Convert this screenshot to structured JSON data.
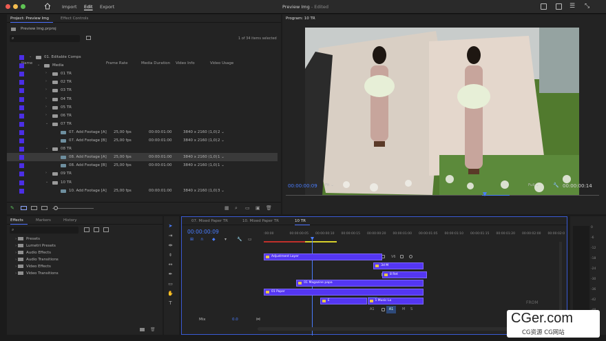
{
  "topbar": {
    "home_icon": "home-icon",
    "nav": [
      "Import",
      "Edit",
      "Export"
    ],
    "active": "Edit",
    "title": "Preview Img",
    "title_suffix": " - Edited"
  },
  "project": {
    "tabs": [
      "Project: Preview Img",
      "Effect Controls"
    ],
    "path": "Preview Img.prproj",
    "search_placeholder": "",
    "count": "1 of 34 items selected",
    "columns": [
      "Name",
      "Frame Rate",
      "Media Duration",
      "Video Info",
      "Video Usage"
    ],
    "rows": [
      {
        "name": "01. Editable Comps",
        "indent": 0,
        "type": "folder",
        "open": true
      },
      {
        "name": "Media",
        "indent": 1,
        "type": "folder",
        "open": true
      },
      {
        "name": "01 TR",
        "indent": 2,
        "type": "folder"
      },
      {
        "name": "02 TR",
        "indent": 2,
        "type": "folder"
      },
      {
        "name": "03 TR",
        "indent": 2,
        "type": "folder"
      },
      {
        "name": "04 TR",
        "indent": 2,
        "type": "folder"
      },
      {
        "name": "05 TR",
        "indent": 2,
        "type": "folder"
      },
      {
        "name": "06 TR",
        "indent": 2,
        "type": "folder"
      },
      {
        "name": "07 TR",
        "indent": 2,
        "type": "folder",
        "open": true
      },
      {
        "name": "07. Add Footage [A]",
        "indent": 3,
        "type": "seq",
        "fps": "25,00 fps",
        "dur": "00:00:01:00",
        "info": "3840 x 2160 (1,0)",
        "usage": "2"
      },
      {
        "name": "07. Add Footage [B]",
        "indent": 3,
        "type": "seq",
        "fps": "25,00 fps",
        "dur": "00:00:01:00",
        "info": "3840 x 2160 (1,0)",
        "usage": "2"
      },
      {
        "name": "08 TR",
        "indent": 2,
        "type": "folder",
        "open": true
      },
      {
        "name": "08. Add Footage [A]",
        "indent": 3,
        "type": "seq",
        "fps": "25,00 fps",
        "dur": "00:00:01:00",
        "info": "3840 x 2160 (1,0)",
        "usage": "1",
        "selected": true
      },
      {
        "name": "08. Add Footage [B]",
        "indent": 3,
        "type": "seq",
        "fps": "25,00 fps",
        "dur": "00:00:01:00",
        "info": "3840 x 2160 (1,0)",
        "usage": "1"
      },
      {
        "name": "09 TR",
        "indent": 2,
        "type": "folder"
      },
      {
        "name": "10 TR",
        "indent": 2,
        "type": "folder",
        "open": true
      },
      {
        "name": "10. Add Footage [A]",
        "indent": 3,
        "type": "seq",
        "fps": "25,00 fps",
        "dur": "00:00:01:00",
        "info": "3840 x 2160 (1,0)",
        "usage": "3"
      }
    ]
  },
  "program": {
    "label": "Program: 10 TR",
    "timecode": "00:00:00:09",
    "fit": "Fit",
    "quality": "Full",
    "duration": "00:00:00:14"
  },
  "effects": {
    "tabs": [
      "Effects",
      "Markers",
      "History"
    ],
    "items": [
      "Presets",
      "Lumetri Presets",
      "Audio Effects",
      "Audio Transitions",
      "Video Effects",
      "Video Transitions"
    ]
  },
  "timeline": {
    "tabs": [
      "07. Mixed Paper TR",
      "10. Mixed Paper TR",
      "10 TR"
    ],
    "timecode": "00:00:00:09",
    "ruler": [
      ":00:00",
      "00:00:00:05",
      "00:00:00:10",
      "00:00:00:15",
      "00:00:00:20",
      "00:00:01:00",
      "00:00:01:05",
      "00:00:01:10",
      "00:00:01:15",
      "00:00:01:20",
      "00:00:02:00",
      "00:00:02:0"
    ],
    "tracks": [
      {
        "id": "V6",
        "clips": [
          {
            "label": "Adjustment Layer",
            "start": 0,
            "end": 0.4
          }
        ]
      },
      {
        "id": "V5",
        "clips": [
          {
            "label": "3d M",
            "start": 0.37,
            "end": 0.54
          }
        ]
      },
      {
        "id": "V4",
        "clips": [
          {
            "label": "8 Ret",
            "start": 0.4,
            "end": 0.55
          }
        ]
      },
      {
        "id": "V3",
        "clips": [
          {
            "label": "01 Magazine papa",
            "start": 0.11,
            "end": 0.54
          }
        ]
      },
      {
        "id": "V2",
        "clips": [
          {
            "label": "01 Paper",
            "start": 0,
            "end": 0.54
          }
        ]
      },
      {
        "id": "V1",
        "clips": [
          {
            "label": "E",
            "start": 0.19,
            "end": 0.35
          },
          {
            "label": "1 Music Lo",
            "start": 0.35,
            "end": 0.54
          }
        ]
      },
      {
        "id": "A1",
        "clips": []
      }
    ],
    "mix_label": "Mix",
    "mix_value": "0.0",
    "a1_src": "A1",
    "v1_src": "V1"
  },
  "meter_scale": [
    "0",
    "-6",
    "-12",
    "-18",
    "-24",
    "-30",
    "-36",
    "-42",
    "-48",
    "dB"
  ],
  "watermark": {
    "main": "CGer.com",
    "sub": "CG资源 CG网站"
  }
}
